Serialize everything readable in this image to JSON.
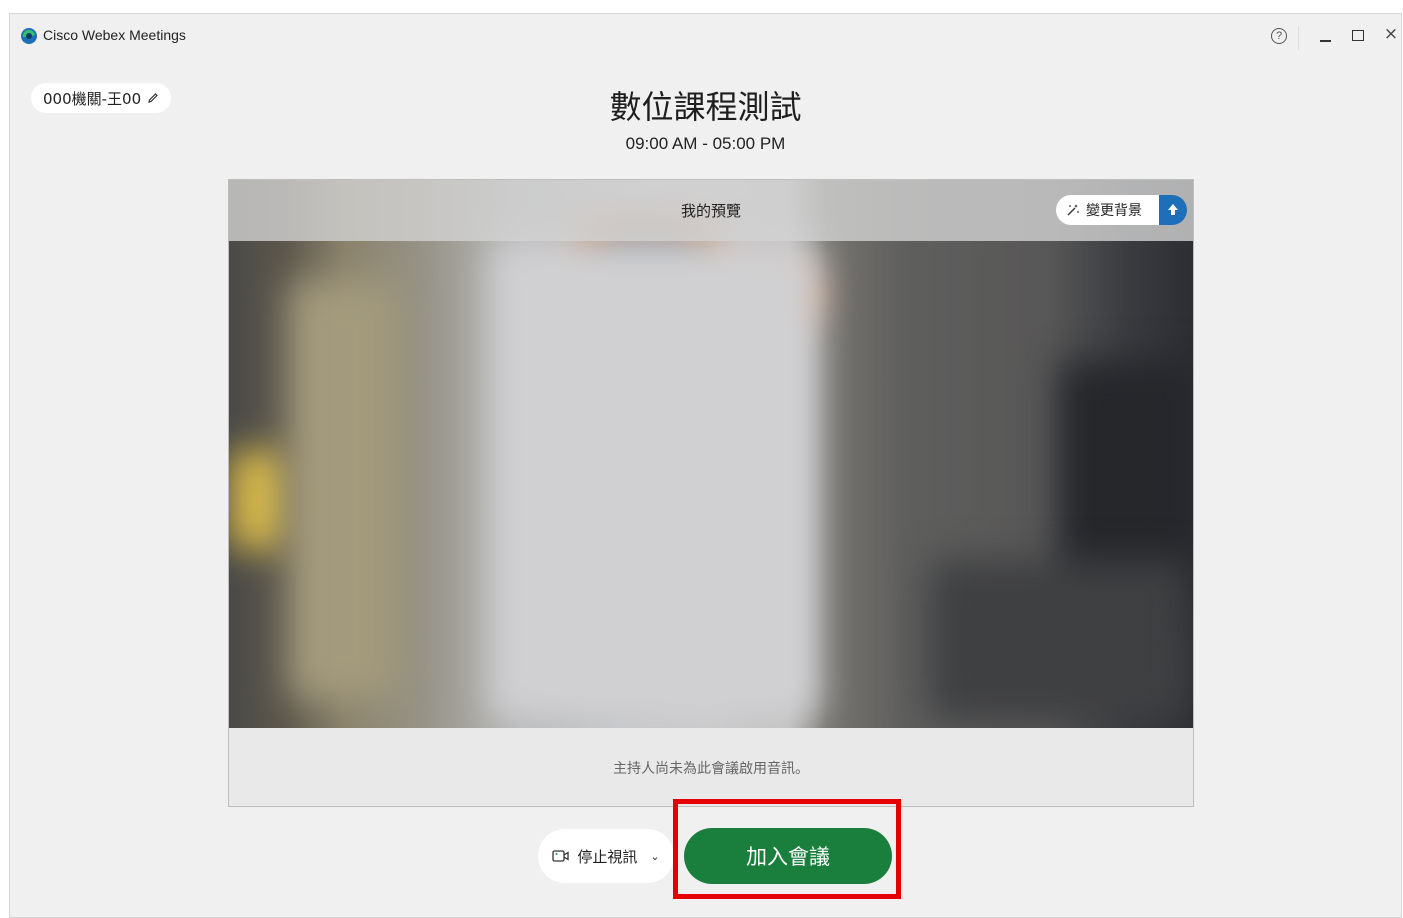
{
  "window": {
    "app_title": "Cisco Webex Meetings",
    "help_glyph": "?",
    "close_glyph": "×"
  },
  "user": {
    "display_name": "000機關-王00"
  },
  "meeting": {
    "title": "數位課程測試",
    "time": "09:00 AM - 05:00 PM"
  },
  "preview": {
    "label": "我的預覽",
    "change_background_label": "變更背景",
    "audio_notice": "主持人尚未為此會議啟用音訊。"
  },
  "controls": {
    "stop_video_label": "停止視訊",
    "join_label": "加入會議"
  },
  "colors": {
    "join_button": "#1a7f3c",
    "highlight": "#e50000",
    "accent_blue": "#1c6fb8"
  },
  "icons": [
    "webex-logo-icon",
    "help-icon",
    "minimize-icon",
    "maximize-icon",
    "close-icon",
    "pencil-icon",
    "magic-wand-icon",
    "background-effects-icon",
    "camera-icon",
    "chevron-down-icon"
  ]
}
